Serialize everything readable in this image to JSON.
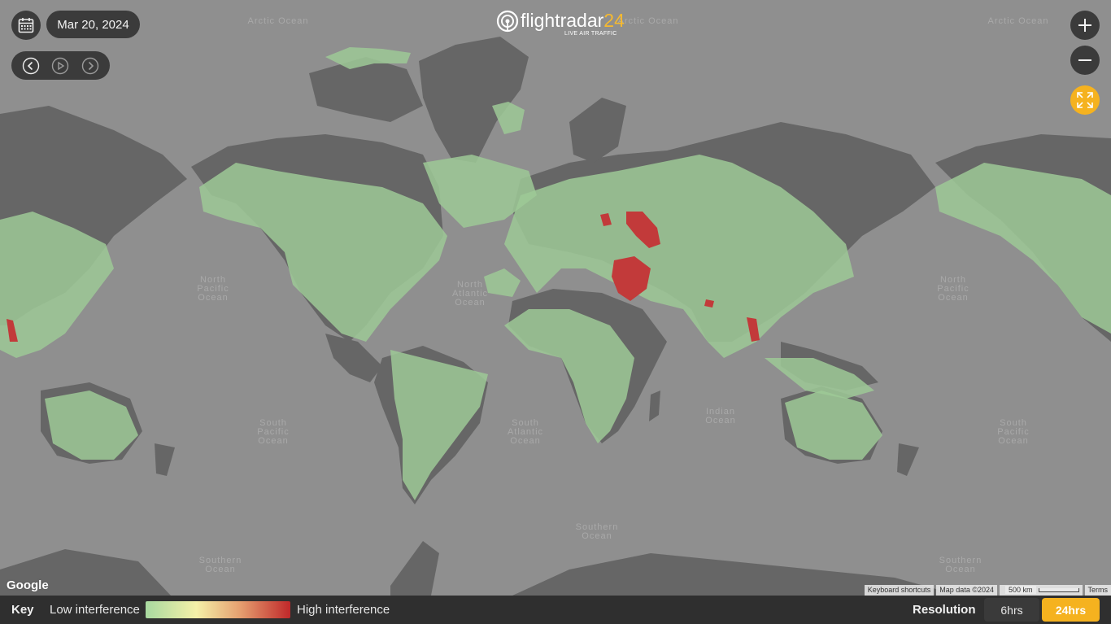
{
  "header": {
    "date": "Mar 20, 2024",
    "logo_word": "flightradar",
    "logo_number": "24",
    "logo_tagline": "LIVE AIR TRAFFIC"
  },
  "controls": {
    "calendar_icon": "calendar-icon",
    "back_icon": "chevron-left-icon",
    "play_icon": "play-icon",
    "forward_icon": "chevron-right-icon",
    "zoom_in_icon": "plus-icon",
    "zoom_out_icon": "minus-icon",
    "fullscreen_icon": "expand-icon"
  },
  "ocean_labels": {
    "arctic_1": "Arctic Ocean",
    "arctic_2": "Arctic Ocean",
    "arctic_3": "Arctic Ocean",
    "north_pacific_1": "North\nPacific\nOcean",
    "north_atlantic": "North\nAtlantic\nOcean",
    "north_pacific_2": "North\nPacific\nOcean",
    "south_pacific_1": "South\nPacific\nOcean",
    "south_atlantic": "South\nAtlantic\nOcean",
    "indian": "Indian\nOcean",
    "south_pacific_2": "South\nPacific\nOcean",
    "southern_1": "Southern\nOcean",
    "southern_2": "Southern\nOcean",
    "southern_3": "Southern\nOcean"
  },
  "map": {
    "provider": "Google",
    "keyboard_shortcuts": "Keyboard shortcuts",
    "map_data": "Map data ©2024",
    "scale": "500 km",
    "terms": "Terms"
  },
  "legend": {
    "key_label": "Key",
    "low_label": "Low interference",
    "high_label": "High interference",
    "colors": {
      "low": "#a8d9a0",
      "mid": "#f4f0a8",
      "high": "#c0282a"
    }
  },
  "resolution": {
    "label": "Resolution",
    "options": [
      "6hrs",
      "24hrs"
    ],
    "selected": "24hrs"
  },
  "colors": {
    "accent": "#f5b21f",
    "ocean": "#8f8f8f",
    "land": "#666666",
    "coverage": "#9dc996",
    "interference": "#c23a3a"
  }
}
